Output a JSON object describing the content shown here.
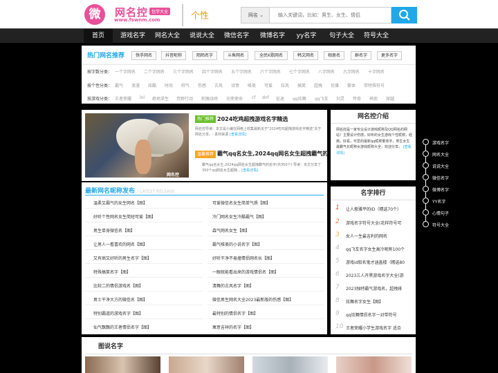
{
  "header": {
    "logo_char": "微",
    "logo_name": "网名控",
    "logo_badge": "包学大全",
    "logo_url": "www.fswnm.com",
    "slogan": "个性",
    "search_select": "网名 ⌄",
    "search_placeholder": "输入关键词，比如：男生、女生、情侣"
  },
  "nav": [
    "首页",
    "游戏名字",
    "网名大全",
    "说说大全",
    "微信名字",
    "微博名字",
    "yy名字",
    "句子大全",
    "符号大全"
  ],
  "hot": {
    "title": "热门网名推荐",
    "tags": [
      "快手网名",
      "抖音昵称",
      "陌陌名字",
      "斗鱼网名",
      "全民K歌网名",
      "韩文网名",
      "相册名",
      "群名字",
      "更多名字"
    ],
    "rows": [
      {
        "label": "按字数分类：",
        "items": [
          "一个字网名",
          "二个字网名",
          "三个字网名",
          "四个字网名",
          "五个字网名",
          "六个字网名",
          "七个字网名",
          "八字网名",
          "九字网名",
          "十字网名"
        ]
      },
      {
        "label": "按个性分类：",
        "items": [
          "霸气",
          "浪漫",
          "炫酷",
          "时尚",
          "帅气",
          "伤感",
          "古风",
          "诗意",
          "唯美",
          "可爱",
          "拉风",
          "搞笑",
          "超拽",
          "优雅",
          "繁体",
          "带特殊符号"
        ]
      },
      {
        "label": "按游戏分类：",
        "items": [
          "王者荣耀",
          "lol",
          "绝地求生",
          "荒野行动",
          "刺激战场",
          "光荣使命",
          "cf",
          "dnf",
          "征途",
          "qq炫舞",
          "qq飞车",
          "刘灵",
          "传奇",
          "神武",
          "穿越"
        ]
      }
    ]
  },
  "featured": {
    "image_watermark": "网名控",
    "items": [
      {
        "badge": "热门推荐",
        "title": "2024吃鸡超拽游戏名字精选",
        "desc": "网名控导读：本文是小编在网络上收集最新关于\"2024吃鸡超拽游戏名字精选\"关于网名分享。- 素材来源",
        "link": "[查看详情]"
      },
      {
        "badge": "温馨推荐",
        "title": "霸气qq名女生,2024qq网名女生超拽霸气的",
        "desc": "霸气qq名女生,2024qq网名女生超拽霸气的名字(共350个) 导读：本文分享了350个qq网名女生超拽...",
        "link": "[查看详情]"
      }
    ]
  },
  "release": {
    "title": "最新网名昵称发布",
    "title_en": "/ LATEST RELEASE",
    "left": [
      "温柔又霸气的女生网名【图】",
      "好听个性网名女生简短可爱【图】",
      "男生单身微信名【图】",
      "让男人一看喜欢的网名【图】",
      "又有病又好听的男生名字【图】",
      "特殊搞笑名字【图】",
      "比较二的情侣游戏名【图】",
      "男士干净大方的微信名【图】",
      "特别霸道的游戏名字【图】",
      "仙气飘飘的王者情侣名字【图】"
    ],
    "right": [
      "可爱微信名女生简单气质【图】",
      "冷门网名女生冷酷霸气【图】",
      "森气网名女生【图】",
      "霸气唯美的小说名字【图】",
      "好听干净不易撞情侣网名长【图】",
      "一眼就能看出来的游戏情侣名【图】",
      "清舞的古风名字【图】",
      "微信男生网名大全2023最新版的伤感【图】",
      "最特别的情侣名字【图】",
      "寓意吉祥的名字【图】"
    ]
  },
  "intro": {
    "title": "网名控介绍",
    "text": "网名控是一家专业设计游戏昵称及QQ网名的网站！主要设计伤感，好听的女生游戏个性昵称，经典，好看，可爱的最新qq昵称繁体字，男生女生最霸气长昵称女游戏昵称大全，欢迎分享。",
    "link": "[查看详情]"
  },
  "ranking": {
    "title": "名字排行",
    "items": [
      {
        "num": "1",
        "text": "让人惹雅平的ID（精选70个）"
      },
      {
        "num": "2",
        "text": "游戏名字符号大全(花样符号可"
      },
      {
        "num": "3",
        "text": "女人一生最吉利的网名"
      },
      {
        "num": "4",
        "text": "qq飞车名字女生高冷昵称100个"
      },
      {
        "num": "5",
        "text": "游戏id取名鬼才涵盖楼（精选80"
      },
      {
        "num": "6",
        "text": "2023三人开黑游戏名字大全(游"
      },
      {
        "num": "7",
        "text": "2023独特霸气游戏名，超拽排"
      },
      {
        "num": "8",
        "text": "炫舞名字女生【图】"
      },
      {
        "num": "9",
        "text": "qq炫舞情侣名字一对带符号"
      },
      {
        "num": "10",
        "text": "王者荣耀小学生游戏名字 适合"
      }
    ]
  },
  "side_nav": [
    "游戏名字",
    "网名大全",
    "说说大全",
    "微信名字",
    "微博名字",
    "YY名字",
    "心情句子",
    "符号大全"
  ],
  "section_title": "图说名字",
  "colors": {
    "accent": "#20a8e8",
    "brand": "#e8509a",
    "badge_hot": "#6cbf2e",
    "badge_warm": "#f5a623",
    "rank_1": "#e8403c",
    "rank_2": "#e87a3c",
    "rank_3": "#e8b23c"
  }
}
